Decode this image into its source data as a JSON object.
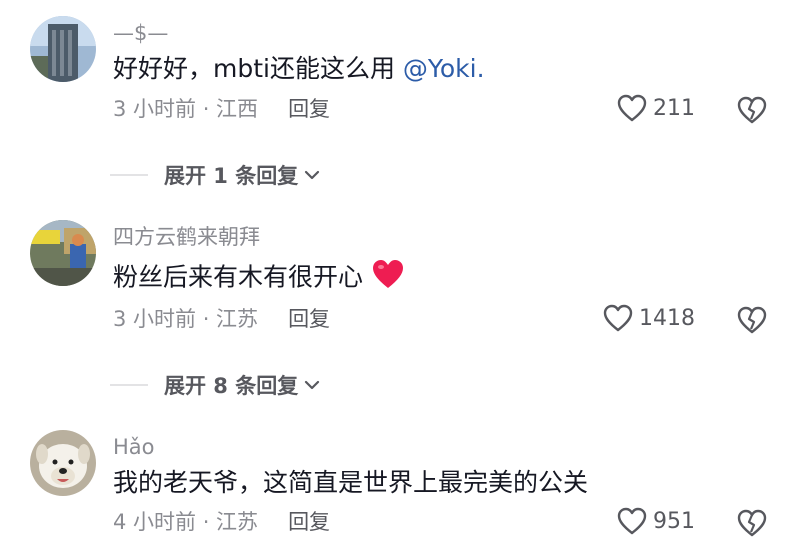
{
  "comments": [
    {
      "author": "—$—",
      "text": "好好好，mbti还能这么用 ",
      "mention": "@Yoki.",
      "time_location": "3 小时前 · 江西",
      "reply_label": "回复",
      "likes": "211",
      "expand_label": "展开 1 条回复"
    },
    {
      "author": "四方云鹤来朝拜",
      "text": "粉丝后来有木有很开心",
      "emoji": "red-heart",
      "time_location": "3 小时前 · 江苏",
      "reply_label": "回复",
      "likes": "1418",
      "expand_label": "展开 8 条回复"
    },
    {
      "author": "Hǎo",
      "text": "我的老天爷，这简直是世界上最完美的公关",
      "time_location": "4 小时前 · 江苏",
      "reply_label": "回复",
      "likes": "951"
    }
  ],
  "colors": {
    "text": "#161823",
    "secondary": "#8a8b91",
    "mention": "#2c5ca8",
    "heart": "#ee1d52"
  }
}
